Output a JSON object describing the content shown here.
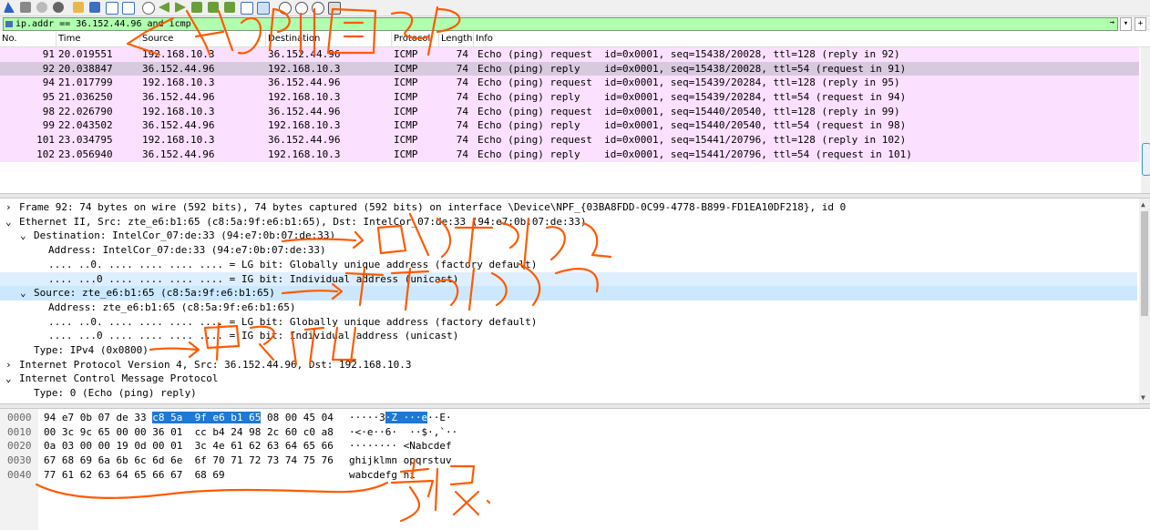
{
  "filter": {
    "value": "ip.addr == 36.152.44.96 and icmp",
    "arrow_glyph": "→",
    "dropdown_glyph": "▾",
    "plus_glyph": "+"
  },
  "packet_list": {
    "columns": [
      "No.",
      "Time",
      "Source",
      "Destination",
      "Protocol",
      "Length",
      "Info"
    ],
    "rows": [
      {
        "no": "91",
        "time": "20.019551",
        "src": "192.168.10.3",
        "dst": "36.152.44.96",
        "proto": "ICMP",
        "len": "74",
        "info": "Echo (ping) request  id=0x0001, seq=15438/20028, ttl=128 (reply in 92)"
      },
      {
        "no": "92",
        "time": "20.038847",
        "src": "36.152.44.96",
        "dst": "192.168.10.3",
        "proto": "ICMP",
        "len": "74",
        "info": "Echo (ping) reply    id=0x0001, seq=15438/20028, ttl=54 (request in 91)"
      },
      {
        "no": "94",
        "time": "21.017799",
        "src": "192.168.10.3",
        "dst": "36.152.44.96",
        "proto": "ICMP",
        "len": "74",
        "info": "Echo (ping) request  id=0x0001, seq=15439/20284, ttl=128 (reply in 95)"
      },
      {
        "no": "95",
        "time": "21.036250",
        "src": "36.152.44.96",
        "dst": "192.168.10.3",
        "proto": "ICMP",
        "len": "74",
        "info": "Echo (ping) reply    id=0x0001, seq=15439/20284, ttl=54 (request in 94)"
      },
      {
        "no": "98",
        "time": "22.026790",
        "src": "192.168.10.3",
        "dst": "36.152.44.96",
        "proto": "ICMP",
        "len": "74",
        "info": "Echo (ping) request  id=0x0001, seq=15440/20540, ttl=128 (reply in 99)"
      },
      {
        "no": "99",
        "time": "22.043502",
        "src": "36.152.44.96",
        "dst": "192.168.10.3",
        "proto": "ICMP",
        "len": "74",
        "info": "Echo (ping) reply    id=0x0001, seq=15440/20540, ttl=54 (request in 98)"
      },
      {
        "no": "101",
        "time": "23.034795",
        "src": "192.168.10.3",
        "dst": "36.152.44.96",
        "proto": "ICMP",
        "len": "74",
        "info": "Echo (ping) request  id=0x0001, seq=15441/20796, ttl=128 (reply in 102)"
      },
      {
        "no": "102",
        "time": "23.056940",
        "src": "36.152.44.96",
        "dst": "192.168.10.3",
        "proto": "ICMP",
        "len": "74",
        "info": "Echo (ping) reply    id=0x0001, seq=15441/20796, ttl=54 (request in 101)"
      }
    ],
    "selected_row": 1
  },
  "details": {
    "lines": [
      {
        "text": "Frame 92: 74 bytes on wire (592 bits), 74 bytes captured (592 bits) on interface \\Device\\NPF_{03BA8FDD-0C99-4778-B899-FD1EA10DF218}, id 0",
        "arrow": "›"
      },
      {
        "text": "Ethernet II, Src: zte_e6:b1:65 (c8:5a:9f:e6:b1:65), Dst: IntelCor_07:de:33 (94:e7:0b:07:de:33)",
        "arrow": "⌄"
      },
      {
        "text": "Destination: IntelCor_07:de:33 (94:e7:0b:07:de:33)",
        "arrow": "⌄"
      },
      {
        "text": "Address: IntelCor_07:de:33 (94:e7:0b:07:de:33)",
        "arrow": ""
      },
      {
        "text": ".... ..0. .... .... .... .... = LG bit: Globally unique address (factory default)",
        "arrow": ""
      },
      {
        "text": ".... ...0 .... .... .... .... = IG bit: Individual address (unicast)",
        "arrow": ""
      },
      {
        "text": "Source: zte_e6:b1:65 (c8:5a:9f:e6:b1:65)",
        "arrow": "⌄"
      },
      {
        "text": "Address: zte_e6:b1:65 (c8:5a:9f:e6:b1:65)",
        "arrow": ""
      },
      {
        "text": ".... ..0. .... .... .... .... = LG bit: Globally unique address (factory default)",
        "arrow": ""
      },
      {
        "text": ".... ...0 .... .... .... .... = IG bit: Individual address (unicast)",
        "arrow": ""
      },
      {
        "text": "Type: IPv4 (0x0800)",
        "arrow": ""
      },
      {
        "text": "Internet Protocol Version 4, Src: 36.152.44.96, Dst: 192.168.10.3",
        "arrow": "›"
      },
      {
        "text": "Internet Control Message Protocol",
        "arrow": "⌄"
      },
      {
        "text": "Type: 0 (Echo (ping) reply)",
        "arrow": ""
      }
    ]
  },
  "bytes": {
    "rows": [
      {
        "offset": "0000",
        "hex_a": "94 e7 0b 07 de 33 ",
        "hex_sel": "c8 5a  9f e6 b1 65",
        "hex_b": " 08 00 45 04",
        "ascii_a": "·····3",
        "ascii_sel": "·Z ···e",
        "ascii_b": "··E·"
      },
      {
        "offset": "0010",
        "hex_a": "00 3c 9c 65 00 00 36 01  cc b4 24 98 2c 60 c0 a8",
        "hex_sel": "",
        "hex_b": "",
        "ascii_a": "·<·e··6·  ··$·,`··",
        "ascii_sel": "",
        "ascii_b": ""
      },
      {
        "offset": "0020",
        "hex_a": "0a 03 00 00 19 0d 00 01  3c 4e 61 62 63 64 65 66",
        "hex_sel": "",
        "hex_b": "",
        "ascii_a": "········ <Nabcdef",
        "ascii_sel": "",
        "ascii_b": ""
      },
      {
        "offset": "0030",
        "hex_a": "67 68 69 6a 6b 6c 6d 6e  6f 70 71 72 73 74 75 76",
        "hex_sel": "",
        "hex_b": "",
        "ascii_a": "ghijklmn opqrstuv",
        "ascii_sel": "",
        "ascii_b": ""
      },
      {
        "offset": "0040",
        "hex_a": "77 61 62 63 64 65 66 67  68 69",
        "hex_sel": "",
        "hex_b": "",
        "ascii_a": "wabcdefg hi",
        "ascii_sel": "",
        "ascii_b": ""
      }
    ]
  },
  "colors": {
    "filter_bg": "#afffaf",
    "icmp_row": "#fce0ff",
    "selected_row": "#d9c9df",
    "detail_highlight": "#cce8ff",
    "byte_selection": "#1e78d4",
    "annotation": "#ff5a00"
  },
  "icons": [
    "shark-fin-icon",
    "stop-icon",
    "restart-icon",
    "options-icon",
    "open-icon",
    "save-icon",
    "close-file-icon",
    "reload-icon",
    "find-icon",
    "back-icon",
    "forward-icon",
    "go-to-icon",
    "first-icon",
    "last-icon",
    "autoscroll-icon",
    "colorize-icon",
    "zoom-in-icon",
    "zoom-out-icon",
    "normal-size-icon",
    "resize-columns-icon"
  ]
}
